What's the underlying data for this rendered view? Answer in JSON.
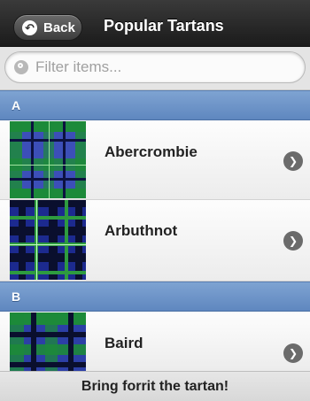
{
  "header": {
    "back_label": "Back",
    "title": "Popular Tartans"
  },
  "filter": {
    "placeholder": "Filter items..."
  },
  "sections": [
    {
      "letter": "A",
      "items": [
        {
          "name": "Abercrombie"
        },
        {
          "name": "Arbuthnot"
        }
      ]
    },
    {
      "letter": "B",
      "items": [
        {
          "name": "Baird"
        }
      ]
    }
  ],
  "footer": {
    "text": "Bring forrit the tartan!"
  },
  "colors": {
    "header_bg": "#262626",
    "divider_bg": "#6e95c9",
    "tartan_blue": "#3c4fb8",
    "tartan_green": "#1d8a3a"
  },
  "icons": {
    "back": "back-arrow-icon",
    "search": "search-icon",
    "row_arrow": "chevron-right-icon"
  }
}
